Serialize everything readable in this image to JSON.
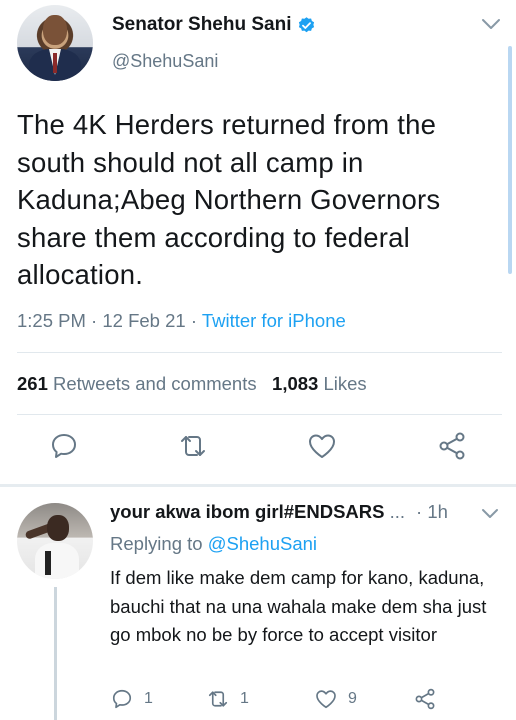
{
  "tweet": {
    "author_name": "Senator Shehu Sani",
    "handle": "@ShehuSani",
    "text": "The 4K Herders returned from the south should not all camp in Kaduna;Abeg Northern Governors share them according to federal allocation.",
    "time": "1:25 PM",
    "date": "12 Feb 21",
    "source": "Twitter for iPhone",
    "sep": "·",
    "retweets_count": "261",
    "retweets_label": "Retweets and comments",
    "likes_count": "1,083",
    "likes_label": "Likes"
  },
  "reply": {
    "author_name": "your akwa ibom girl#ENDSARS",
    "ellipsis": "...",
    "sep": "·",
    "time": "1h",
    "replying_prefix": "Replying to",
    "replying_handle": "@ShehuSani",
    "text": "If dem like make dem camp for kano, kaduna, bauchi that na una wahala make dem sha just go mbok no be by force to accept visitor",
    "reply_count": "1",
    "retweet_count": "1",
    "like_count": "9"
  },
  "colors": {
    "accent": "#1da1f2",
    "muted": "#657786",
    "text": "#14171a",
    "divider": "#e1e8ed"
  },
  "icons": {
    "verified": "verified-badge-icon",
    "chevron": "chevron-down-icon",
    "reply": "reply-icon",
    "retweet": "retweet-icon",
    "like": "heart-icon",
    "share": "share-icon"
  }
}
